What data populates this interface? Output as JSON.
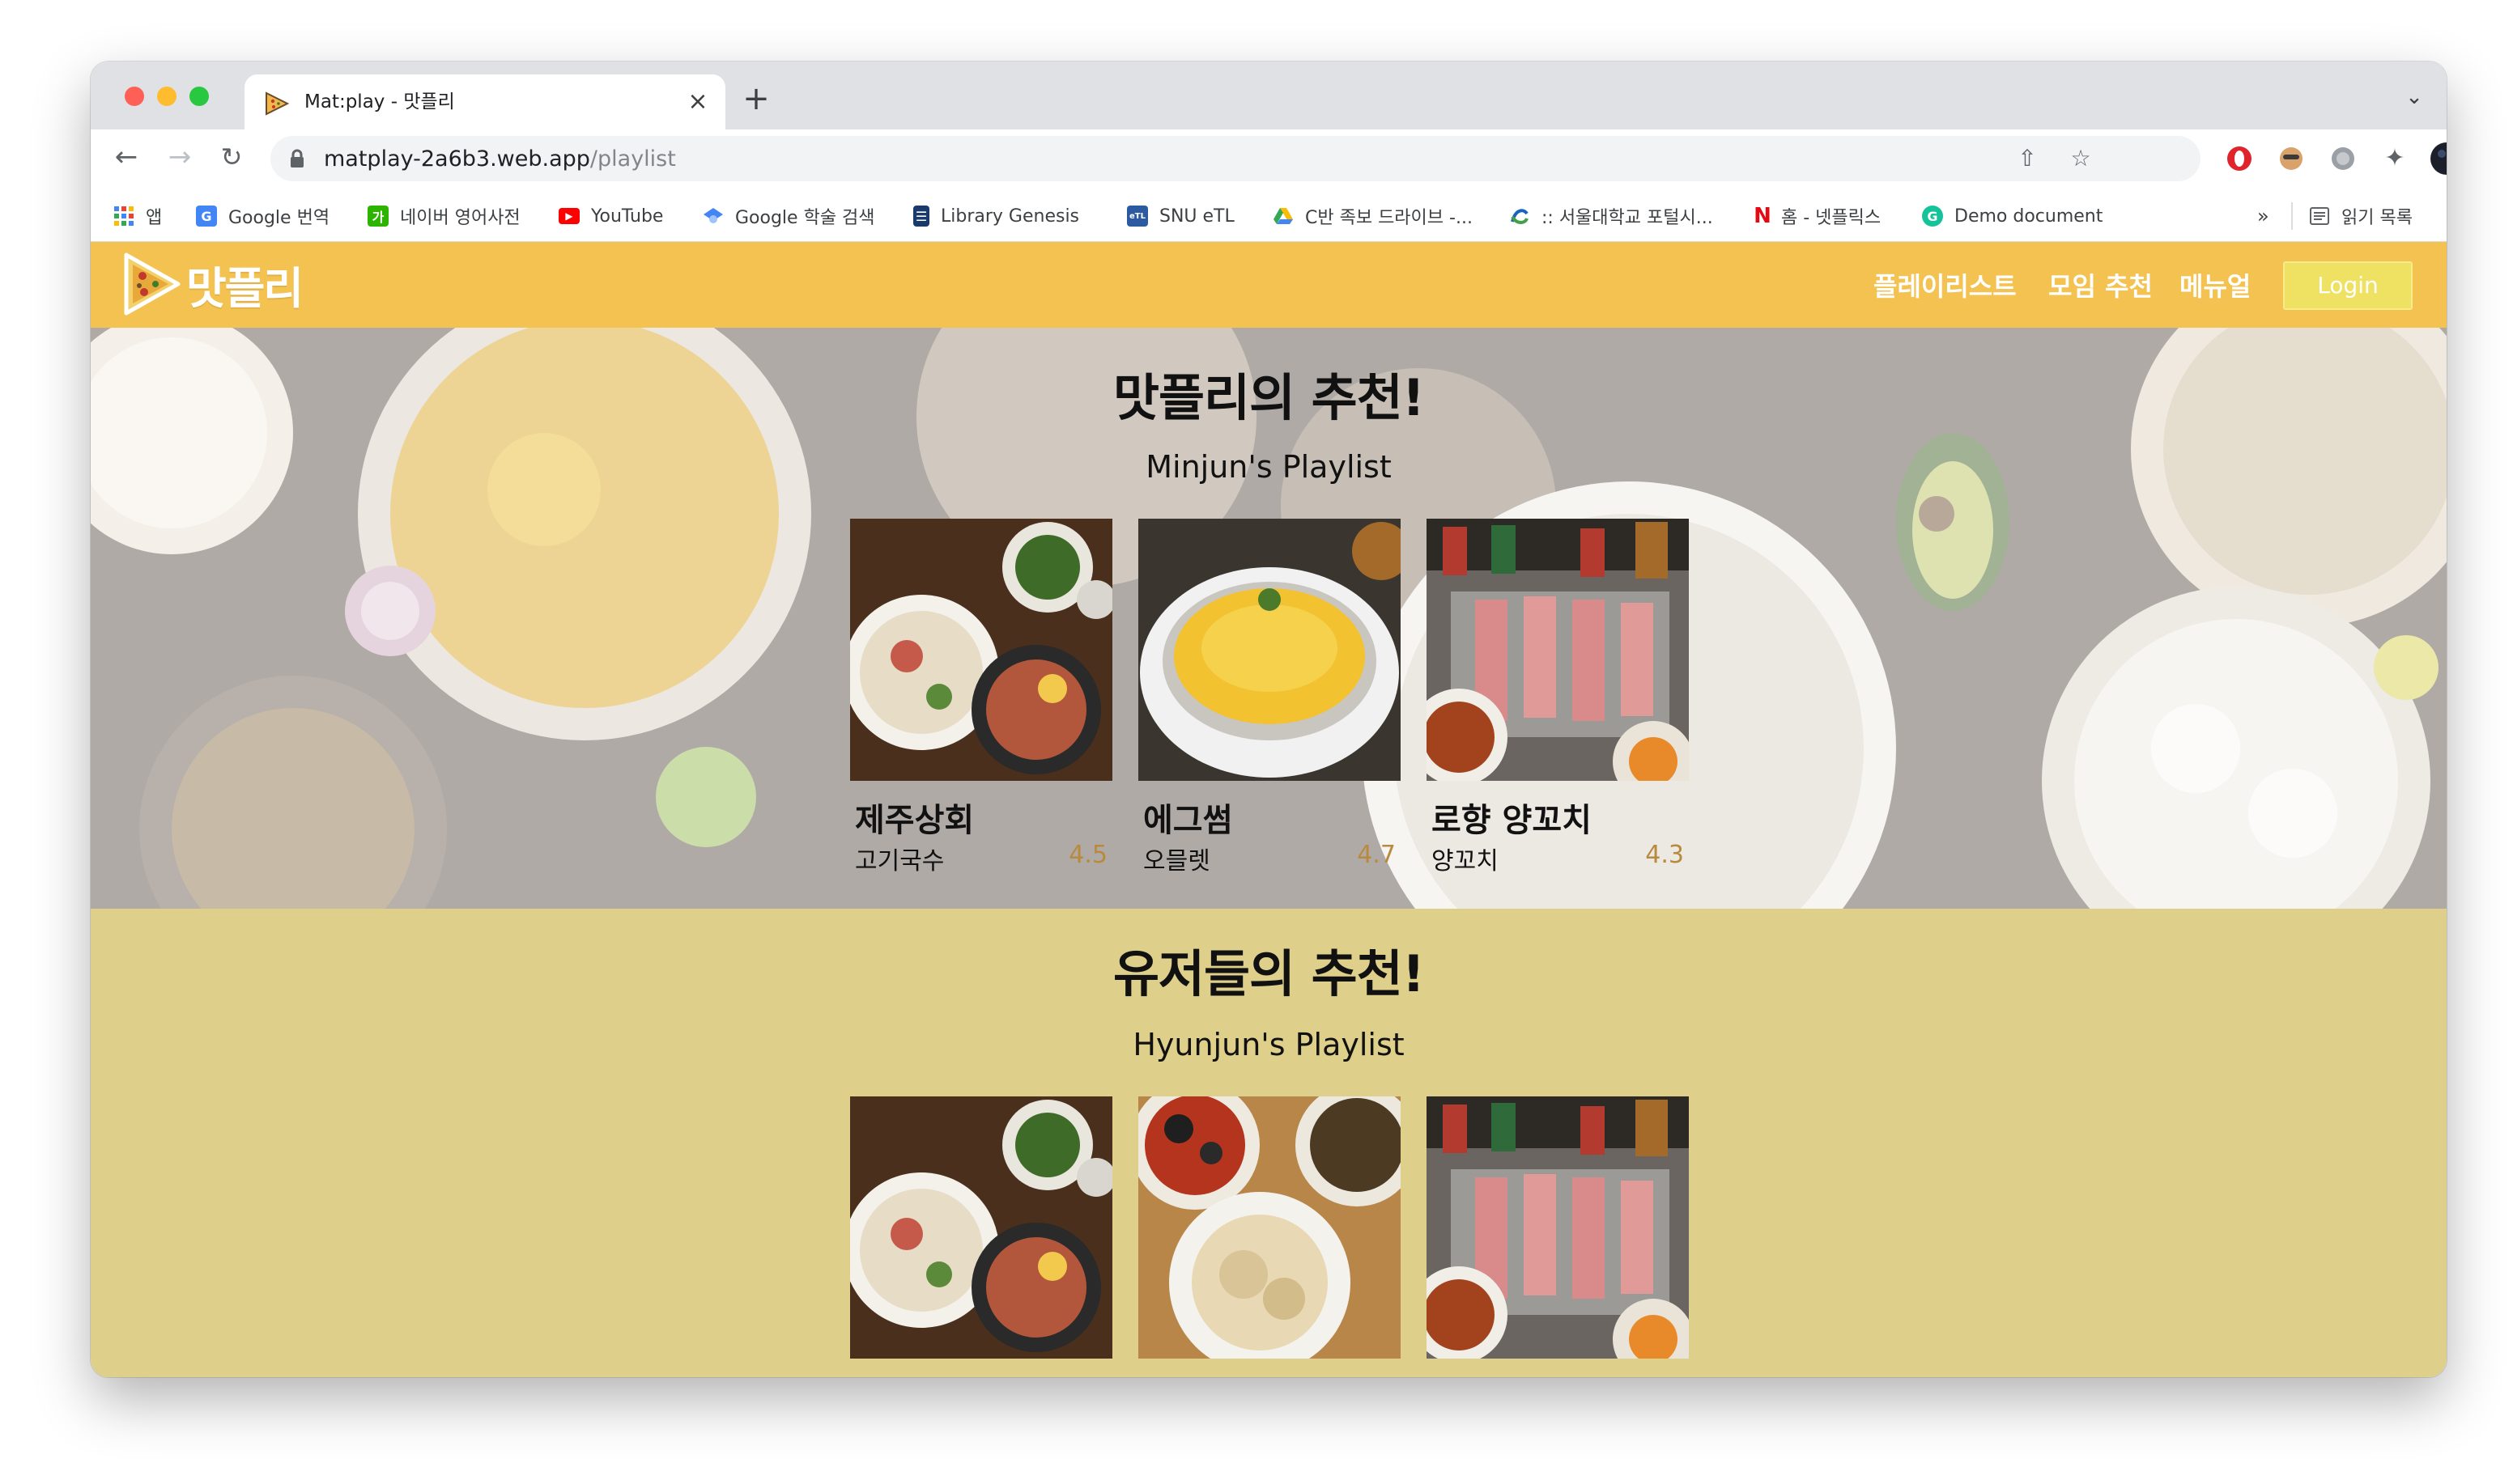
{
  "browser": {
    "tab_title": "Mat:play - 맛플리",
    "new_tab": "+",
    "close_tab": "×",
    "url_host": "matplay-2a6b3.web.app",
    "url_path": "/playlist",
    "bookmarks": [
      {
        "label": "앱",
        "icon": "apps-grid-icon",
        "color": "#4285f4"
      },
      {
        "label": "Google 번역",
        "icon": "google-translate-icon",
        "color": "#4285f4"
      },
      {
        "label": "네이버 영어사전",
        "icon": "naver-dictionary-icon",
        "color": "#2db400"
      },
      {
        "label": "YouTube",
        "icon": "youtube-icon",
        "color": "#ff0000"
      },
      {
        "label": "Google 학술 검색",
        "icon": "google-scholar-icon",
        "color": "#4285f4"
      },
      {
        "label": "Library Genesis",
        "icon": "library-genesis-icon",
        "color": "#1a3a6b"
      },
      {
        "label": "SNU eTL",
        "icon": "snu-etl-icon",
        "color": "#2c5aa0"
      },
      {
        "label": "C반 족보 드라이브 -...",
        "icon": "google-drive-icon",
        "color": "#0f9d58"
      },
      {
        "label": ":: 서울대학교 포털시...",
        "icon": "snu-portal-icon",
        "color": "#1565c0"
      },
      {
        "label": "홈 - 넷플릭스",
        "icon": "netflix-icon",
        "color": "#e50914"
      },
      {
        "label": "Demo document",
        "icon": "grammarly-icon",
        "color": "#15c39a"
      }
    ],
    "overflow": "»",
    "reading_list": "읽기 목록"
  },
  "site": {
    "logo_text": "맛플리",
    "nav": [
      "플레이리스트",
      "모임 추천",
      "메뉴얼"
    ],
    "login": "Login",
    "hero": {
      "title": "맛플리의 추천!",
      "playlist_name": "Minjun's Playlist",
      "cards": [
        {
          "name": "제주상회",
          "category": "고기국수",
          "rating": "4.5",
          "photo": "noodle-soup"
        },
        {
          "name": "에그썸",
          "category": "오믈렛",
          "rating": "4.7",
          "photo": "omelette"
        },
        {
          "name": "로향 양꼬치",
          "category": "양꼬치",
          "rating": "4.3",
          "photo": "lamb-skewers"
        }
      ]
    },
    "users": {
      "title": "유저들의 추천!",
      "playlist_name": "Hyunjun's Playlist",
      "cards": [
        {
          "photo": "noodle-soup"
        },
        {
          "photo": "chinese-dishes"
        },
        {
          "photo": "lamb-skewers"
        }
      ]
    }
  },
  "colors": {
    "header": "#f4c251",
    "login_button": "#efe262",
    "users_section": "#ded08b",
    "rating": "#b88a3e"
  }
}
